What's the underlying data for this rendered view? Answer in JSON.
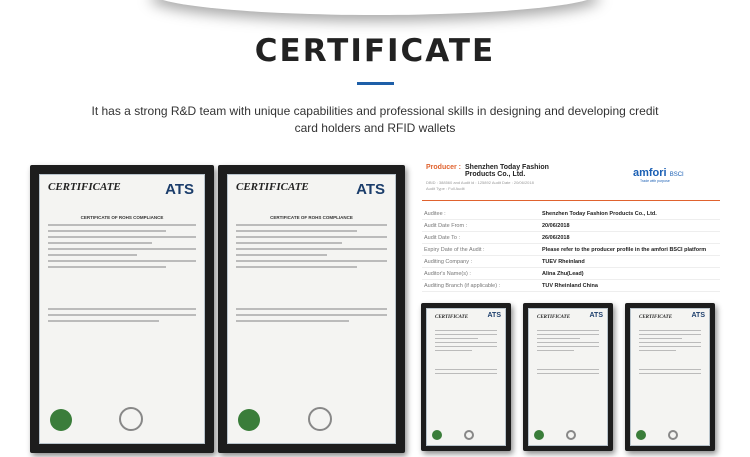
{
  "title": "CERTIFICATE",
  "intro": "It has a strong R&D team with unique capabilities and professional skills in designing and developing credit card holders and RFID wallets",
  "certs": [
    {
      "heading": "CERTIFICATE",
      "logo": "ATS",
      "doc_title": "CERTIFICATE OF ROHS COMPLIANCE"
    },
    {
      "heading": "CERTIFICATE",
      "logo": "ATS",
      "doc_title": "CERTIFICATE OF ROHS COMPLIANCE"
    }
  ],
  "audit": {
    "producer_label": "Producer :",
    "producer_name": "Shenzhen Today Fashion Products Co., Ltd.",
    "meta1": "DBID : 388560 and Audit id : 125892      Audit Date : 20/06/2018",
    "meta2": "Audit Type : Full Audit",
    "logo": "amfori",
    "logo_suffix": "BSCI",
    "tagline": "Trade with purpose",
    "rows": [
      {
        "label": "Auditee :",
        "value": "Shenzhen Today Fashion Products Co., Ltd."
      },
      {
        "label": "Audit Date From :",
        "value": "20/06/2018"
      },
      {
        "label": "Audit Date To :",
        "value": "26/06/2018"
      },
      {
        "label": "Expiry Date of the Audit :",
        "value": "Please refer to the producer profile in the amfori BSCI platform"
      },
      {
        "label": "Auditing Company :",
        "value": "TUEV Rheinland"
      },
      {
        "label": "Auditor's Name(s) :",
        "value": "Alina Zhu(Lead)"
      },
      {
        "label": "Auditing Branch (if applicable) :",
        "value": "TUV Rheinland China"
      }
    ]
  },
  "small_certs": [
    {
      "heading": "CERTIFICATE",
      "logo": "ATS"
    },
    {
      "heading": "CERTIFICATE",
      "logo": "ATS"
    },
    {
      "heading": "CERTIFICATE",
      "logo": "ATS"
    }
  ]
}
